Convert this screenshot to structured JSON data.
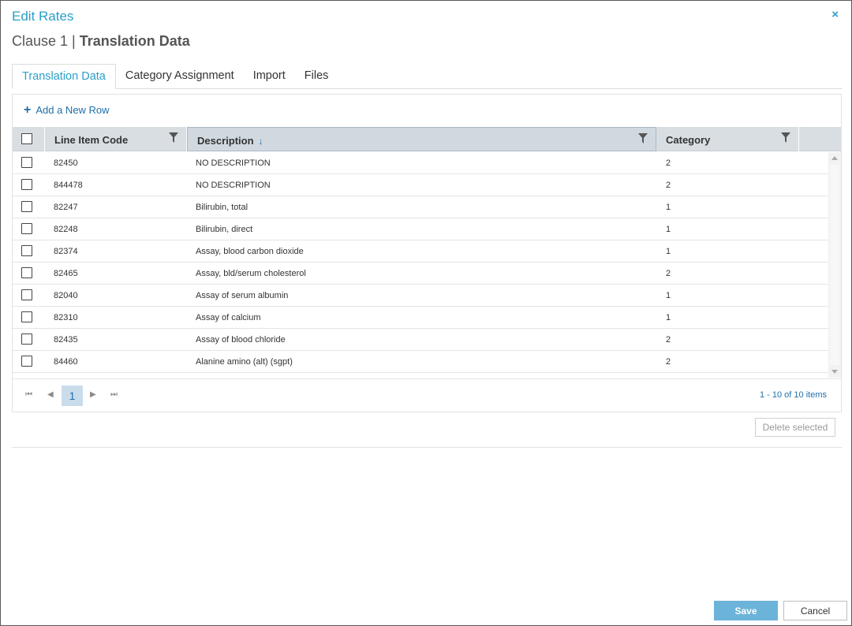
{
  "dialog": {
    "title": "Edit Rates",
    "close_label": "×",
    "subtitle_prefix": "Clause 1 | ",
    "subtitle_strong": "Translation Data"
  },
  "tabs": [
    {
      "label": "Translation Data",
      "active": true
    },
    {
      "label": "Category Assignment",
      "active": false
    },
    {
      "label": "Import",
      "active": false
    },
    {
      "label": "Files",
      "active": false
    }
  ],
  "toolbar": {
    "add_icon": "+",
    "add_label": "Add a New Row"
  },
  "grid": {
    "columns": [
      {
        "label": "Line Item Code",
        "filter_icon": "filter-icon"
      },
      {
        "label": "Description",
        "sort_icon": "↓",
        "filter_icon": "filter-icon"
      },
      {
        "label": "Category",
        "filter_icon": "filter-icon"
      }
    ],
    "rows": [
      {
        "code": "82450",
        "description": "NO DESCRIPTION",
        "category": "2"
      },
      {
        "code": "844478",
        "description": "NO DESCRIPTION",
        "category": "2"
      },
      {
        "code": "82247",
        "description": "Bilirubin, total",
        "category": "1"
      },
      {
        "code": "82248",
        "description": "Bilirubin, direct",
        "category": "1"
      },
      {
        "code": "82374",
        "description": "Assay, blood carbon dioxide",
        "category": "1"
      },
      {
        "code": "82465",
        "description": "Assay, bld/serum cholesterol",
        "category": "2"
      },
      {
        "code": "82040",
        "description": "Assay of serum albumin",
        "category": "1"
      },
      {
        "code": "82310",
        "description": "Assay of calcium",
        "category": "1"
      },
      {
        "code": "82435",
        "description": "Assay of blood chloride",
        "category": "2"
      },
      {
        "code": "84460",
        "description": "Alanine amino (alt) (sgpt)",
        "category": "2"
      }
    ]
  },
  "pager": {
    "first_icon": "⏮",
    "prev_icon": "◀",
    "current_page": "1",
    "next_icon": "▶",
    "last_icon": "⏭",
    "info": "1 - 10 of 10 items"
  },
  "actions": {
    "delete_selected": "Delete selected",
    "save": "Save",
    "cancel": "Cancel"
  },
  "colors": {
    "accent": "#2a9fc9",
    "link": "#1f6fa8",
    "header_bg": "#d9dee3",
    "save_bg": "#6cb3d9"
  }
}
